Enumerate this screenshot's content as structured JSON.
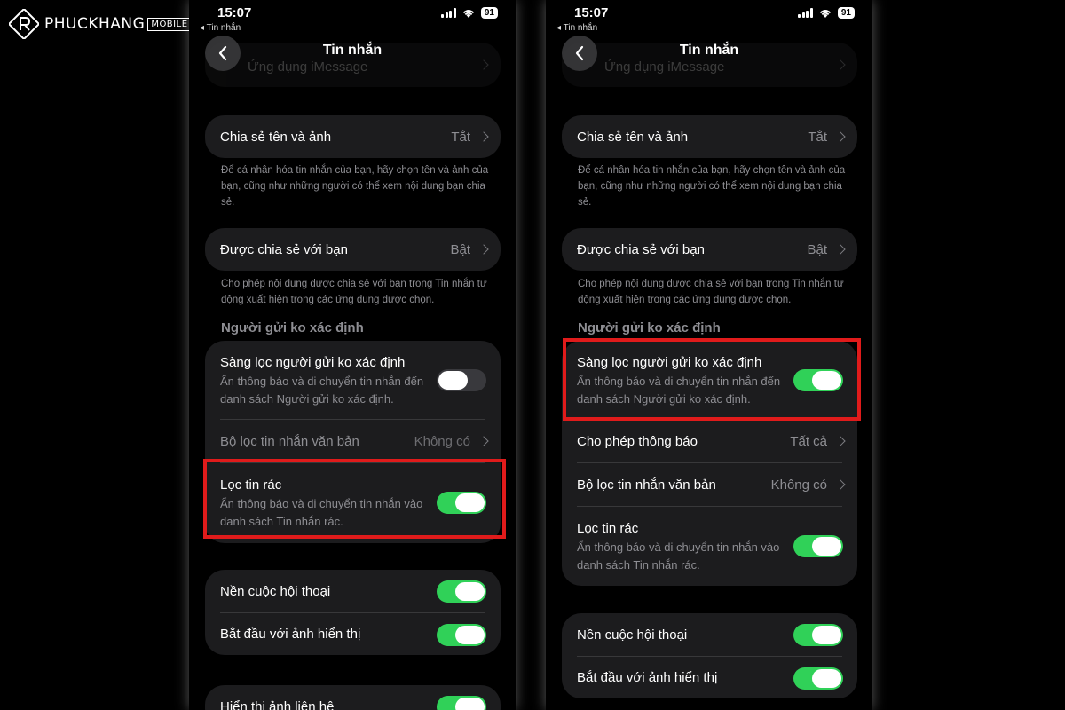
{
  "watermark": {
    "brand": "PHUCKHANG",
    "suffix": "MOBILE"
  },
  "status": {
    "time": "15:07",
    "back_app": "◂ Tin nhắn",
    "battery": "91"
  },
  "nav": {
    "title": "Tin nhắn"
  },
  "top_partial_row": "Ứng dụng iMessage",
  "share_name": {
    "label": "Chia sẻ tên và ảnh",
    "value": "Tắt",
    "note": "Để cá nhân hóa tin nhắn của bạn, hãy chọn tên và ảnh của bạn, cũng như những người có thể xem nội dung bạn chia sẻ."
  },
  "shared_with_you": {
    "label": "Được chia sẻ với bạn",
    "value": "Bật",
    "note": "Cho phép nội dung được chia sẻ với bạn trong Tin nhắn tự động xuất hiện trong các ứng dụng được chọn."
  },
  "unknown_header": "Người gửi ko xác định",
  "filter_unknown": {
    "title": "Sàng lọc người gửi ko xác định",
    "subtitle": "Ẩn thông báo và di chuyển tin nhắn đến danh sách Người gửi ko xác định."
  },
  "allow_notifications": {
    "label": "Cho phép thông báo",
    "value": "Tất cả"
  },
  "text_filter": {
    "label": "Bộ lọc tin nhắn văn bản",
    "value": "Không có"
  },
  "junk_filter": {
    "title": "Lọc tin rác",
    "subtitle": "Ẩn thông báo và di chuyển tin nhắn vào danh sách Tin nhắn rác."
  },
  "conversation_bg": {
    "label": "Nền cuộc hội thoại"
  },
  "start_with_photo": {
    "label": "Bắt đầu với ảnh hiển thị"
  },
  "show_contact_photos": {
    "label": "Hiển thị ảnh liên hệ"
  },
  "states": {
    "left": {
      "filter_unknown": false,
      "junk_filter": true,
      "conversation_bg": true,
      "start_with_photo": true,
      "show_contact_photos": true
    },
    "right": {
      "filter_unknown": true,
      "junk_filter": true,
      "conversation_bg": true,
      "start_with_photo": true
    }
  },
  "colors": {
    "toggle_on": "#30d158",
    "toggle_off": "#39393d",
    "highlight": "#e01b1b",
    "card": "#1c1c1e"
  }
}
